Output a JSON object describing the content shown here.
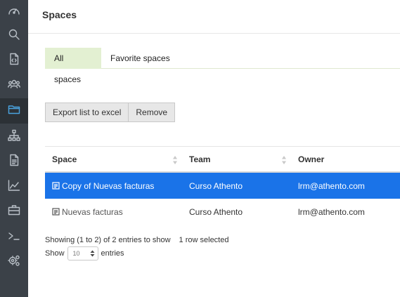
{
  "sidebar": {
    "items": [
      {
        "icon": "dashboard-icon"
      },
      {
        "icon": "search-icon"
      },
      {
        "icon": "code-file-icon"
      },
      {
        "icon": "users-icon"
      },
      {
        "icon": "folder-icon",
        "active": true
      },
      {
        "icon": "hierarchy-icon"
      },
      {
        "icon": "document-icon"
      },
      {
        "icon": "area-chart-icon"
      },
      {
        "icon": "briefcase-icon"
      },
      {
        "icon": "terminal-icon"
      },
      {
        "icon": "settings-gears-icon"
      }
    ],
    "active_color": "#4aa3df"
  },
  "header": {
    "title": "Spaces"
  },
  "tabs": [
    {
      "label": "All spaces",
      "active": true
    },
    {
      "label": "Favorite spaces",
      "active": false
    }
  ],
  "actions": {
    "export_label": "Export list to excel",
    "remove_label": "Remove"
  },
  "table": {
    "columns": [
      "Space",
      "Team",
      "Owner"
    ],
    "rows": [
      {
        "space": "Copy of Nuevas facturas",
        "team": "Curso Athento",
        "owner": "lrm@athento.com",
        "selected": true
      },
      {
        "space": "Nuevas facturas",
        "team": "Curso Athento",
        "owner": "lrm@athento.com",
        "selected": false
      }
    ],
    "selected_color": "#1a73e8"
  },
  "footer": {
    "showing": "Showing (1 to 2) of 2 entries to show",
    "selected": "1 row selected",
    "show_label": "Show",
    "page_length": "10",
    "entries_label": "entries"
  }
}
